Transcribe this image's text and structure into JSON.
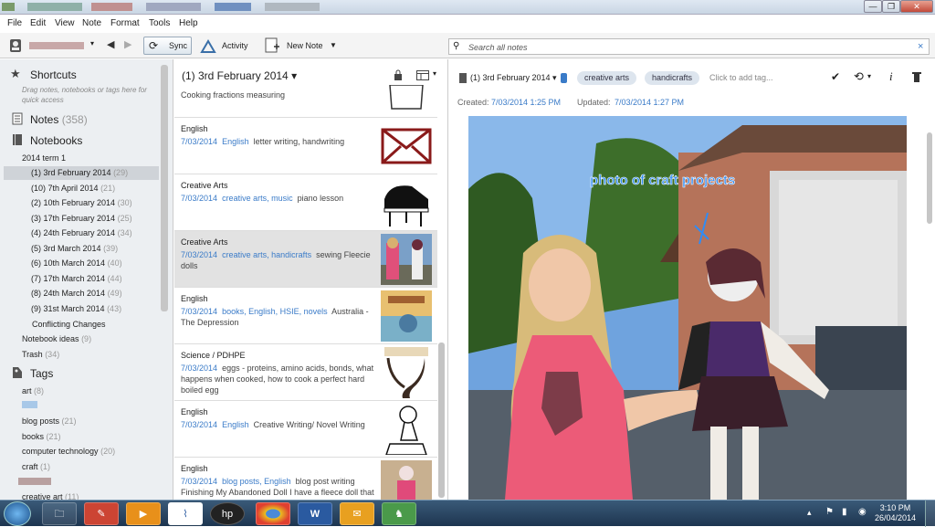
{
  "menu": [
    "File",
    "Edit",
    "View",
    "Note",
    "Format",
    "Tools",
    "Help"
  ],
  "toolbar": {
    "sync": "Sync",
    "activity": "Activity",
    "new_note": "New Note"
  },
  "search": {
    "placeholder": "Search all notes",
    "close": "×"
  },
  "window": {
    "min": "—",
    "max": "❐",
    "close": "✕"
  },
  "sidebar": {
    "shortcuts": "Shortcuts",
    "shortcuts_hint": "Drag notes, notebooks or tags here for quick access",
    "notes_label": "Notes",
    "notes_count": "(358)",
    "notebooks": "Notebooks",
    "stack": "2014 term 1",
    "notebook_items": [
      {
        "label": "(1) 3rd February 2014",
        "count": "(29)"
      },
      {
        "label": "(10) 7th April 2014",
        "count": "(21)"
      },
      {
        "label": "(2) 10th February 2014",
        "count": "(30)"
      },
      {
        "label": "(3) 17th February 2014",
        "count": "(25)"
      },
      {
        "label": "(4) 24th February 2014",
        "count": "(34)"
      },
      {
        "label": "(5) 3rd March 2014",
        "count": "(39)"
      },
      {
        "label": "(6) 10th March 2014",
        "count": "(40)"
      },
      {
        "label": "(7) 17th March 2014",
        "count": "(44)"
      },
      {
        "label": "(8) 24th March 2014",
        "count": "(49)"
      },
      {
        "label": "(9) 31st March 2014",
        "count": "(43)"
      }
    ],
    "conflicting": "Conflicting Changes",
    "notebook_ideas": "Notebook ideas",
    "notebook_ideas_count": "(9)",
    "trash": "Trash",
    "trash_count": "(34)",
    "tags": "Tags",
    "tag_items": [
      {
        "label": "art",
        "count": "(8)"
      },
      {
        "label": "blog posts",
        "count": "(21)"
      },
      {
        "label": "books",
        "count": "(21)"
      },
      {
        "label": "computer technology",
        "count": "(20)"
      },
      {
        "label": "craft",
        "count": "(1)"
      },
      {
        "label": "creative art",
        "count": "(11)"
      }
    ]
  },
  "list": {
    "title": "(1) 3rd February 2014",
    "partial_snip": "Cooking fractions measuring",
    "notes": [
      {
        "title": "English",
        "date": "7/03/2014",
        "tags": "English",
        "text": "letter writing, handwriting"
      },
      {
        "title": "Creative Arts",
        "date": "7/03/2014",
        "tags": "creative arts, music",
        "text": "piano lesson"
      },
      {
        "title": "Creative Arts",
        "date": "7/03/2014",
        "tags": "creative arts, handicrafts",
        "text": "sewing Fleecie dolls"
      },
      {
        "title": "English",
        "date": "7/03/2014",
        "tags": "books, English, HSIE, novels",
        "text": "Australia - The Depression"
      },
      {
        "title": "Science / PDHPE",
        "date": "7/03/2014",
        "tags": "",
        "text": "eggs - proteins, amino acids, bonds, what happens when cooked, how to cook a perfect hard boiled egg"
      },
      {
        "title": "English",
        "date": "7/03/2014",
        "tags": "English",
        "text": "Creative Writing/ Novel Writing"
      },
      {
        "title": "English",
        "date": "7/03/2014",
        "tags": "blog posts, English",
        "text": "blog post writing Finishing My Abandoned Doll I have a fleece doll that"
      }
    ]
  },
  "note": {
    "notebook": "(1) 3rd February 2014",
    "tag1": "creative arts",
    "tag2": "handicrafts",
    "add_tag": "Click to add tag...",
    "created_label": "Created:",
    "created": "7/03/2014 1:25 PM",
    "updated_label": "Updated:",
    "updated": "7/03/2014 1:27 PM",
    "photo_caption": "photo of craft projects"
  },
  "clock": {
    "time": "3:10 PM",
    "date": "26/04/2014"
  },
  "colors": {
    "accent": "#3a7bc8",
    "caption": "#2f8cf5"
  }
}
